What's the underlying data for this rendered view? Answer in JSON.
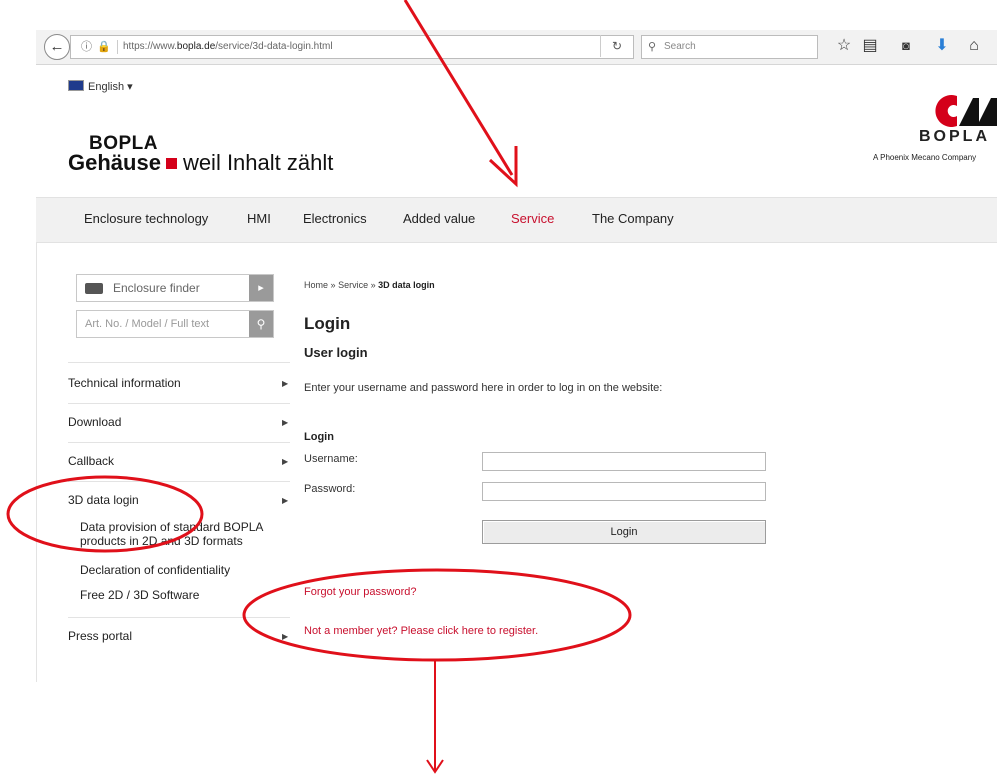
{
  "browser": {
    "url_prefix": "https://www.",
    "url_domain": "bopla.de",
    "url_path": "/service/3d-data-login.html",
    "search_placeholder": "Search",
    "back_glyph": "←",
    "reload_glyph": "C",
    "icons": [
      "star-icon",
      "reading-list-icon",
      "pocket-icon",
      "download-icon",
      "home-icon"
    ]
  },
  "header": {
    "language": "English",
    "brand_name": "BOPLA",
    "tagline_part1": "Gehäuse",
    "tagline_part2": "weil Inhalt zählt",
    "logo_text": "BOPLA",
    "logo_sub": "A Phoenix Mecano Company",
    "accent_color": "#d4001a"
  },
  "nav": {
    "items": [
      "Enclosure technology",
      "HMI",
      "Electronics",
      "Added value",
      "Service",
      "The Company"
    ],
    "active": "Service",
    "active_color": "#c8102e"
  },
  "sidebar": {
    "finder_label": "Enclosure finder",
    "search_placeholder": "Art. No. / Model / Full text",
    "items": [
      "Technical information",
      "Download",
      "Callback",
      "3D data login",
      "Press portal"
    ],
    "subitems": [
      "Data provision of standard BOPLA products in 2D and 3D formats",
      "Declaration of confidentiality",
      "Free 2D / 3D Software"
    ]
  },
  "main": {
    "breadcrumb_home": "Home",
    "breadcrumb_service": "Service",
    "breadcrumb_current": "3D data login",
    "breadcrumb_sep": "»",
    "title": "Login",
    "subtitle": "User login",
    "intro": "Enter your username and password here in order to log in on the website:",
    "form_title": "Login",
    "username_label": "Username:",
    "password_label": "Password:",
    "login_button": "Login",
    "forgot_link": "Forgot your password?",
    "register_link": "Not a member yet? Please click here to register."
  },
  "annotations": {
    "color": "#e0101a"
  }
}
